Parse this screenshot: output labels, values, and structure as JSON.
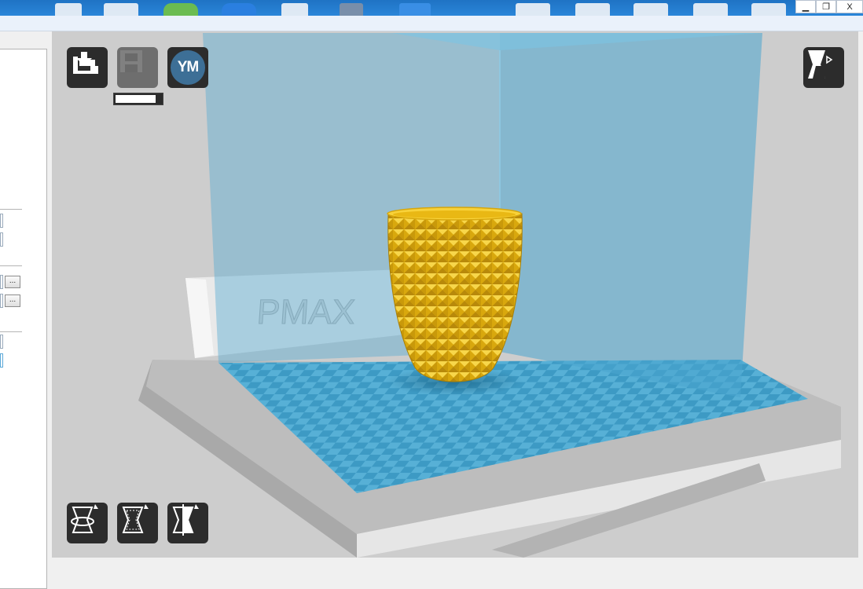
{
  "window": {
    "minimize_icon": "minimize-icon",
    "maximize_icon": "restore-icon",
    "close_label": "X",
    "restore_label": "❐",
    "minimize_label": "▁"
  },
  "left_panel": {
    "browse_button_1": "...",
    "browse_button_2": "..."
  },
  "toolbar": {
    "load_icon": "load-model-icon",
    "save_icon": "save-toolpath-icon",
    "youmagine_label": "YM",
    "view_mode_icon": "view-mode-icon",
    "progress": 0.88
  },
  "scene": {
    "machine_brand": "PMAX",
    "object_color": "#f2c21b",
    "volume_color": "#5aaed3",
    "bed_color": "#3d9ac4"
  },
  "tools": [
    {
      "name": "rotate-tool",
      "icon": "rotate-icon"
    },
    {
      "name": "scale-tool",
      "icon": "scale-icon"
    },
    {
      "name": "mirror-tool",
      "icon": "mirror-icon"
    }
  ]
}
